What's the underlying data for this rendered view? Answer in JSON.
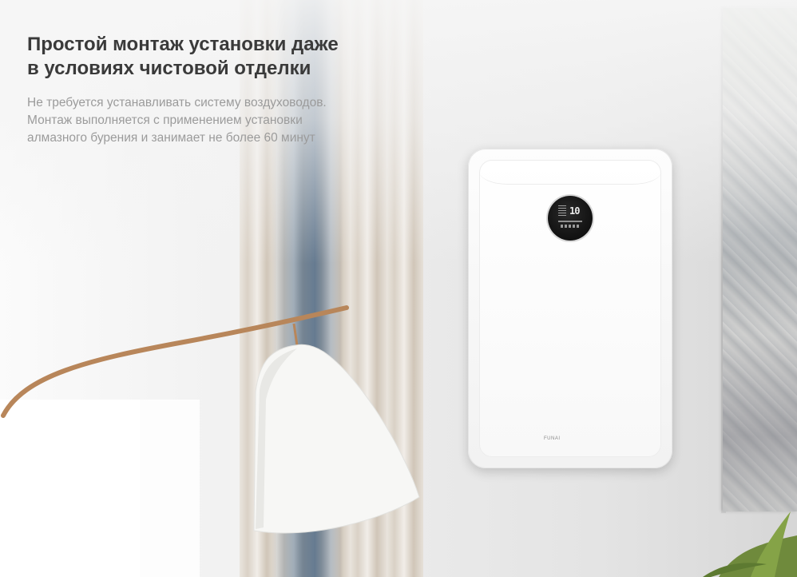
{
  "headline": {
    "line1": "Простой монтаж установки даже",
    "line2": "в условиях чистовой отделки"
  },
  "description": {
    "line1": "Не требуется устанавливать систему воздуховодов.",
    "line2": "Монтаж выполняется с применением установки",
    "line3": "алмазного бурения и занимает не более 60 минут"
  },
  "device": {
    "display_value": "10",
    "brand": "FUNAI"
  },
  "colors": {
    "headline": "#3a3a3a",
    "description": "#9b9b9b",
    "device_body": "#f7f7f7",
    "display": "#141414",
    "curtain_accent": "#34567a",
    "lamp_arm": "#b8865a"
  }
}
